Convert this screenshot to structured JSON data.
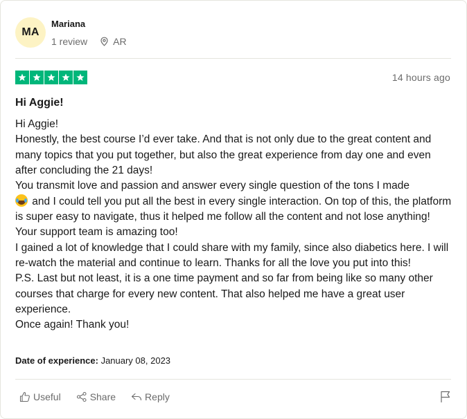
{
  "consumer": {
    "initials": "MA",
    "name": "Mariana",
    "reviews": "1 review",
    "location": "AR"
  },
  "review": {
    "rating": 5,
    "posted": "14 hours ago",
    "title": "Hi Aggie!",
    "paragraphs": {
      "p1": "Hi Aggie!",
      "p2": "Honestly, the best course I’d ever take. And that is not only due to the great content and many topics that you put together, but also the great experience from day one and even after concluding the 21 days!",
      "p3a": "You transmit love and passion and answer every single question of the tons I made",
      "p3b": " and I could tell you put all the best in every single interaction. On top of this, the platform is super easy to navigate, thus it helped me follow all the content and not lose anything! Your support team is amazing too!",
      "p4": "I gained a lot of knowledge that I could share with my family, since also diabetics here. I will re-watch the material and continue to learn. Thanks for all the love you put into this!",
      "p5": "P.S. Last but not least, it is a one time payment and so far from being like so many other courses that charge for every new content. That also helped me have a great user experience.",
      "p6": "Once again! Thank you!"
    },
    "experience_label": "Date of experience:",
    "experience_date": "January 08, 2023"
  },
  "actions": {
    "useful": "Useful",
    "share": "Share",
    "reply": "Reply"
  },
  "icons": {
    "location": "location-pin-icon",
    "star": "star-icon",
    "emoji": "laughing-tears-emoji-icon",
    "useful": "thumbs-up-icon",
    "share": "share-icon",
    "reply": "reply-arrow-icon",
    "flag": "flag-icon"
  },
  "colors": {
    "star_bg": "#00b67a",
    "avatar_bg": "#fdf3c4",
    "muted_text": "#6b6b6b"
  }
}
